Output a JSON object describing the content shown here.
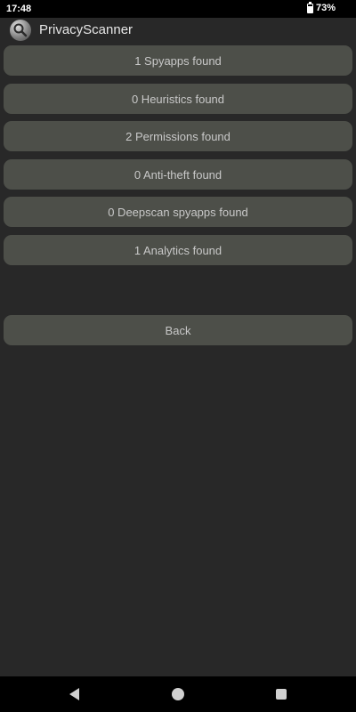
{
  "status_bar": {
    "time": "17:48",
    "battery_percent_label": "73%",
    "battery_level": 0.73
  },
  "app": {
    "title": "PrivacyScanner",
    "icon": "magnifier-icon"
  },
  "results": [
    {
      "label": "1 Spyapps found"
    },
    {
      "label": "0 Heuristics found"
    },
    {
      "label": "2 Permissions found"
    },
    {
      "label": "0 Anti-theft found"
    },
    {
      "label": "0 Deepscan spyapps found"
    },
    {
      "label": "1 Analytics found"
    }
  ],
  "back_button": {
    "label": "Back"
  },
  "nav_bar": {
    "icons": [
      "back-triangle-icon",
      "home-circle-icon",
      "recents-square-icon"
    ]
  },
  "colors": {
    "background": "#282828",
    "button": "#4d4f49",
    "button_text": "#c8c8c8",
    "status_bar": "#000000"
  }
}
